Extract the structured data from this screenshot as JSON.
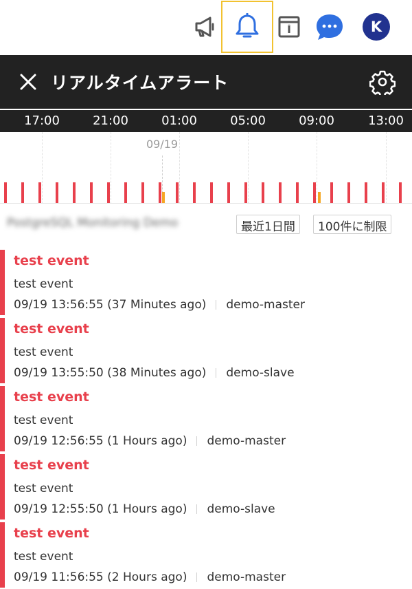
{
  "header": {
    "icons": [
      "megaphone-icon",
      "bell-icon",
      "calendar-info-icon",
      "chat-icon"
    ],
    "avatar_initial": "K",
    "colors": {
      "active_outline": "#f2c230",
      "bell": "#2f6fe0",
      "chat": "#2f6fe0",
      "avatar": "#21328f"
    }
  },
  "panel": {
    "title": "リアルタイムアラート",
    "close_icon": "close-icon",
    "settings_icon": "gear-icon"
  },
  "timeline": {
    "ticks": [
      "17:00",
      "21:00",
      "01:00",
      "05:00",
      "09:00",
      "13:00"
    ],
    "date_label": "09/19",
    "colors": {
      "critical": "#e8404c",
      "warning": "#f5a623"
    }
  },
  "filters": {
    "project_name": "PostgreSQL Monitoring Demo",
    "period_chip": "最近1日間",
    "limit_chip": "100件に制限"
  },
  "alerts": [
    {
      "title": "test event",
      "message": "test event",
      "time": "09/19 13:56:55 (37 Minutes ago)",
      "host": "demo-master"
    },
    {
      "title": "test event",
      "message": "test event",
      "time": "09/19 13:55:50 (38 Minutes ago)",
      "host": "demo-slave"
    },
    {
      "title": "test event",
      "message": "test event",
      "time": "09/19 12:56:55 (1 Hours ago)",
      "host": "demo-master"
    },
    {
      "title": "test event",
      "message": "test event",
      "time": "09/19 12:55:50 (1 Hours ago)",
      "host": "demo-slave"
    },
    {
      "title": "test event",
      "message": "test event",
      "time": "09/19 11:56:55 (2 Hours ago)",
      "host": "demo-master"
    }
  ]
}
